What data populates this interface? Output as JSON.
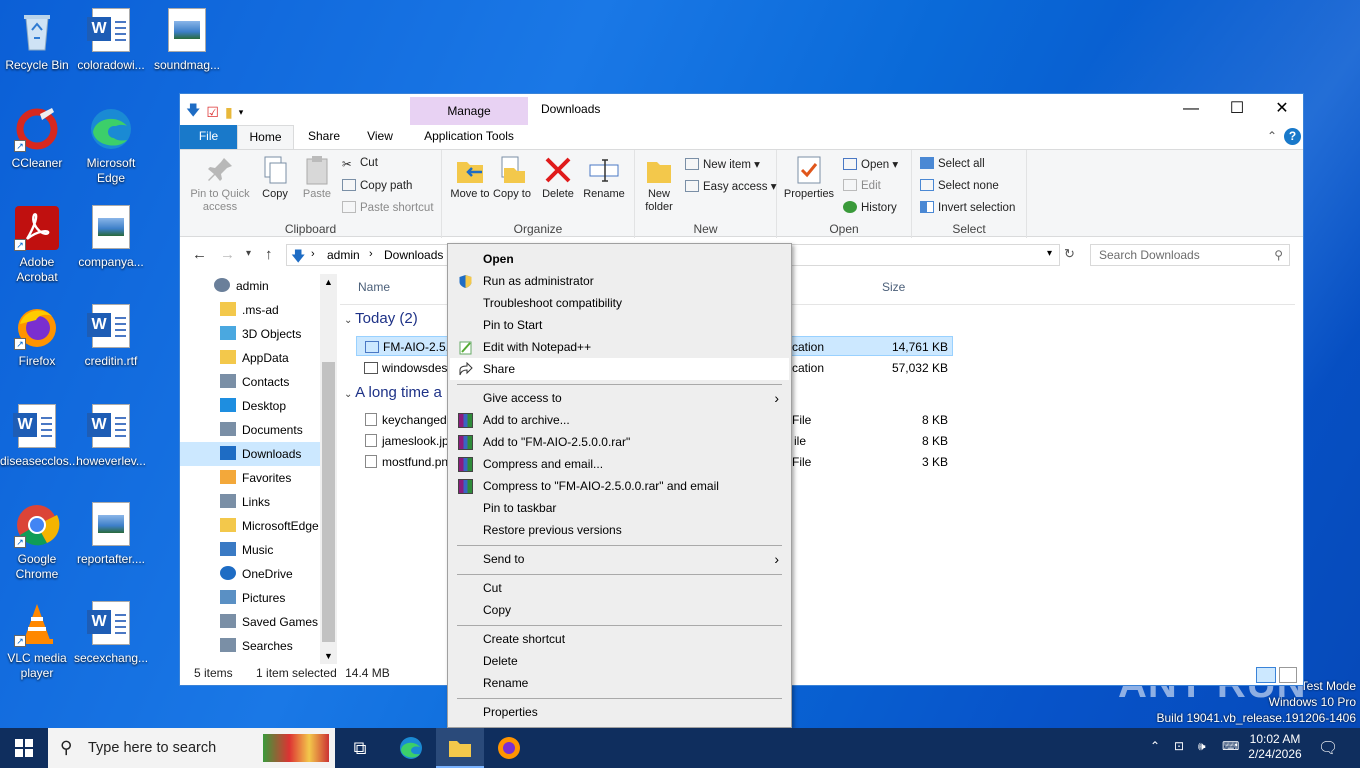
{
  "desktop": {
    "icons": [
      {
        "label": "Recycle Bin",
        "kind": "bin"
      },
      {
        "label": "coloradowi...",
        "kind": "word"
      },
      {
        "label": "soundmag...",
        "kind": "image"
      },
      {
        "label": "CCleaner",
        "kind": "ccleaner"
      },
      {
        "label": "Microsoft Edge",
        "kind": "edge"
      },
      {
        "label": "Adobe Acrobat",
        "kind": "acrobat"
      },
      {
        "label": "companya...",
        "kind": "image"
      },
      {
        "label": "Firefox",
        "kind": "firefox"
      },
      {
        "label": "creditin.rtf",
        "kind": "word"
      },
      {
        "label": "diseasecclos...",
        "kind": "word"
      },
      {
        "label": "howeverlev...",
        "kind": "word"
      },
      {
        "label": "Google Chrome",
        "kind": "chrome"
      },
      {
        "label": "reportafter....",
        "kind": "image"
      },
      {
        "label": "VLC media player",
        "kind": "vlc"
      },
      {
        "label": "secexchang...",
        "kind": "word"
      }
    ]
  },
  "explorer": {
    "title": "Downloads",
    "manage_label": "Manage",
    "tabs": {
      "file": "File",
      "home": "Home",
      "share": "Share",
      "view": "View",
      "app_tools": "Application Tools"
    },
    "ribbon": {
      "clipboard": {
        "label": "Clipboard",
        "pin": "Pin to Quick access",
        "copy": "Copy",
        "paste": "Paste",
        "cut": "Cut",
        "copy_path": "Copy path",
        "paste_shortcut": "Paste shortcut"
      },
      "organize": {
        "label": "Organize",
        "move_to": "Move to",
        "copy_to": "Copy to",
        "delete": "Delete",
        "rename": "Rename"
      },
      "new": {
        "label": "New",
        "new_folder": "New folder",
        "new_item": "New item",
        "easy_access": "Easy access"
      },
      "open": {
        "label": "Open",
        "properties": "Properties",
        "open": "Open",
        "edit": "Edit",
        "history": "History"
      },
      "select": {
        "label": "Select",
        "select_all": "Select all",
        "select_none": "Select none",
        "invert": "Invert selection"
      }
    },
    "address": {
      "crumb1": "admin",
      "crumb2": "Downloads",
      "search_placeholder": "Search Downloads"
    },
    "nav": [
      {
        "label": "admin",
        "kind": "user"
      },
      {
        "label": ".ms-ad",
        "kind": "folder"
      },
      {
        "label": "3D Objects",
        "kind": "3d"
      },
      {
        "label": "AppData",
        "kind": "folder"
      },
      {
        "label": "Contacts",
        "kind": "contacts"
      },
      {
        "label": "Desktop",
        "kind": "desktop"
      },
      {
        "label": "Documents",
        "kind": "documents"
      },
      {
        "label": "Downloads",
        "kind": "downloads"
      },
      {
        "label": "Favorites",
        "kind": "star"
      },
      {
        "label": "Links",
        "kind": "links"
      },
      {
        "label": "MicrosoftEdge",
        "kind": "folder"
      },
      {
        "label": "Music",
        "kind": "music"
      },
      {
        "label": "OneDrive",
        "kind": "cloud"
      },
      {
        "label": "Pictures",
        "kind": "pictures"
      },
      {
        "label": "Saved Games",
        "kind": "games"
      },
      {
        "label": "Searches",
        "kind": "search"
      }
    ],
    "columns": {
      "name": "Name",
      "size": "Size"
    },
    "groups": {
      "today": "Today (2)",
      "long_ago": "A long time a"
    },
    "files_today": [
      {
        "name": "FM-AIO-2.5.0",
        "type": "cation",
        "size": "14,761 KB"
      },
      {
        "name": "windowsdesk",
        "type": "cation",
        "size": "57,032 KB"
      }
    ],
    "files_old": [
      {
        "name": "keychanged.p",
        "type": "File",
        "size": "8 KB"
      },
      {
        "name": "jameslook.jpg",
        "type": "ile",
        "size": "8 KB"
      },
      {
        "name": "mostfund.pn",
        "type": "File",
        "size": "3 KB"
      }
    ],
    "status": {
      "items": "5 items",
      "selected": "1 item selected",
      "size": "14.4 MB"
    }
  },
  "context_menu": {
    "open": "Open",
    "run_admin": "Run as administrator",
    "troubleshoot": "Troubleshoot compatibility",
    "pin_start": "Pin to Start",
    "edit_npp": "Edit with Notepad++",
    "share": "Share",
    "give_access": "Give access to",
    "add_archive": "Add to archive...",
    "add_rar": "Add to \"FM-AIO-2.5.0.0.rar\"",
    "compress_email": "Compress and email...",
    "compress_rar_email": "Compress to \"FM-AIO-2.5.0.0.rar\" and email",
    "pin_taskbar": "Pin to taskbar",
    "restore": "Restore previous versions",
    "send_to": "Send to",
    "cut": "Cut",
    "copy": "Copy",
    "create_shortcut": "Create shortcut",
    "delete": "Delete",
    "rename": "Rename",
    "properties": "Properties"
  },
  "taskbar": {
    "search_placeholder": "Type here to search",
    "time": "10:02 AM",
    "date": "2/24/2026"
  },
  "watermark": {
    "line1": "Test Mode",
    "line2": "Windows 10 Pro",
    "line3": "Build 19041.vb_release.191206-1406",
    "brand": "ANY RUN"
  },
  "colors": {
    "accent": "#1979ca",
    "selection": "#cce8ff",
    "manage": "#e8d2f3",
    "taskbar": "#0f2e5e"
  }
}
